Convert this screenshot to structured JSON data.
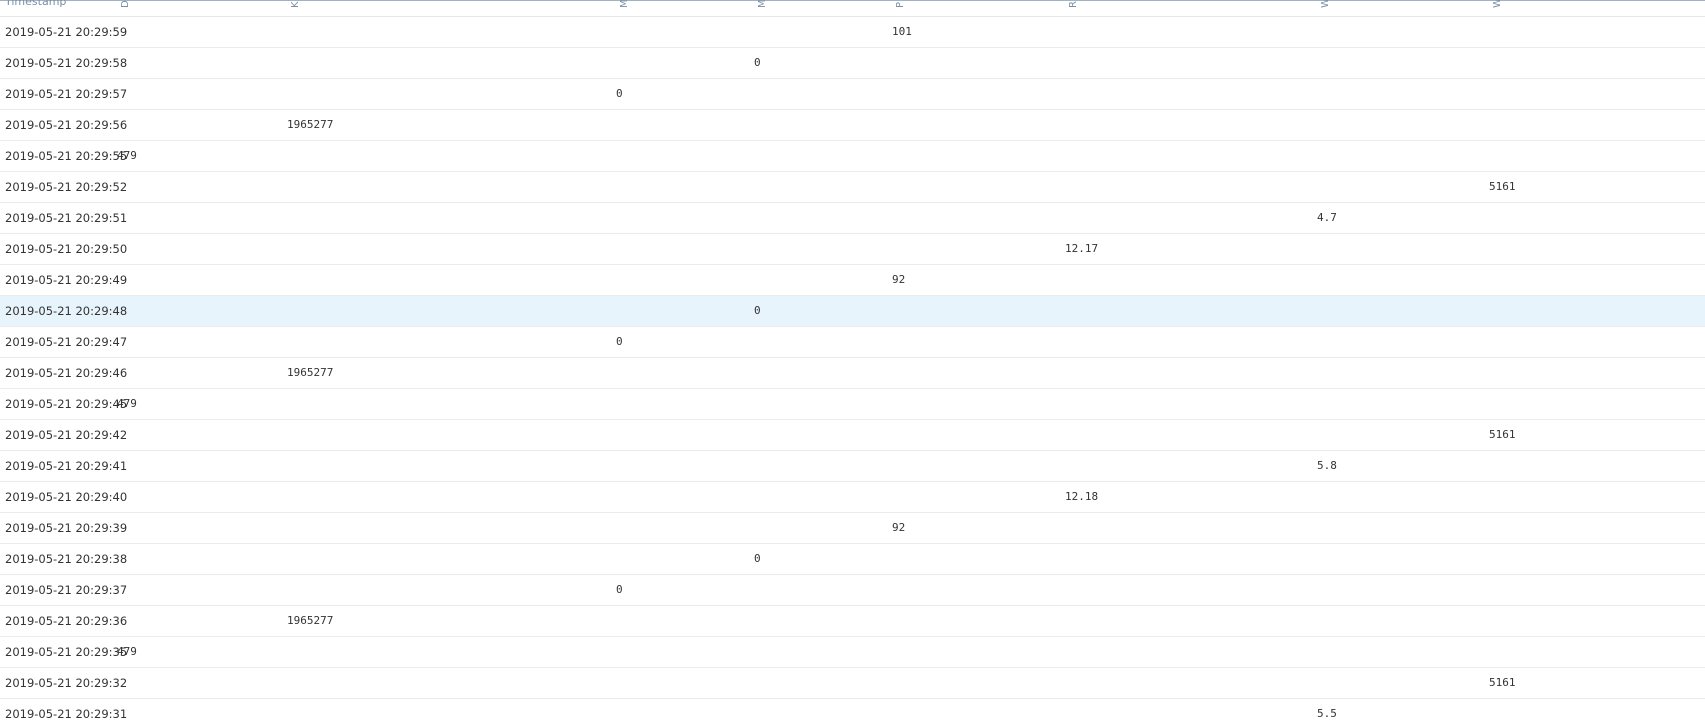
{
  "header": {
    "timestamp_label": "Timestamp",
    "columns": [
      "D",
      "K",
      "M",
      "M",
      "P",
      "R",
      "W",
      "W"
    ]
  },
  "rows": [
    {
      "timestamp": "2019-05-21 20:29:59",
      "col": 4,
      "value": "101"
    },
    {
      "timestamp": "2019-05-21 20:29:58",
      "col": 3,
      "value": "0"
    },
    {
      "timestamp": "2019-05-21 20:29:57",
      "col": 2,
      "value": "0"
    },
    {
      "timestamp": "2019-05-21 20:29:56",
      "col": 1,
      "value": "1965277"
    },
    {
      "timestamp": "2019-05-21 20:29:55",
      "col": 0,
      "value": "479"
    },
    {
      "timestamp": "2019-05-21 20:29:52",
      "col": 7,
      "value": "5161"
    },
    {
      "timestamp": "2019-05-21 20:29:51",
      "col": 6,
      "value": "4.7"
    },
    {
      "timestamp": "2019-05-21 20:29:50",
      "col": 5,
      "value": "12.17"
    },
    {
      "timestamp": "2019-05-21 20:29:49",
      "col": 4,
      "value": "92"
    },
    {
      "timestamp": "2019-05-21 20:29:48",
      "col": 3,
      "value": "0",
      "selected": true
    },
    {
      "timestamp": "2019-05-21 20:29:47",
      "col": 2,
      "value": "0"
    },
    {
      "timestamp": "2019-05-21 20:29:46",
      "col": 1,
      "value": "1965277"
    },
    {
      "timestamp": "2019-05-21 20:29:45",
      "col": 0,
      "value": "479"
    },
    {
      "timestamp": "2019-05-21 20:29:42",
      "col": 7,
      "value": "5161"
    },
    {
      "timestamp": "2019-05-21 20:29:41",
      "col": 6,
      "value": "5.8"
    },
    {
      "timestamp": "2019-05-21 20:29:40",
      "col": 5,
      "value": "12.18"
    },
    {
      "timestamp": "2019-05-21 20:29:39",
      "col": 4,
      "value": "92"
    },
    {
      "timestamp": "2019-05-21 20:29:38",
      "col": 3,
      "value": "0"
    },
    {
      "timestamp": "2019-05-21 20:29:37",
      "col": 2,
      "value": "0"
    },
    {
      "timestamp": "2019-05-21 20:29:36",
      "col": 1,
      "value": "1965277"
    },
    {
      "timestamp": "2019-05-21 20:29:35",
      "col": 0,
      "value": "479"
    },
    {
      "timestamp": "2019-05-21 20:29:32",
      "col": 7,
      "value": "5161"
    },
    {
      "timestamp": "2019-05-21 20:29:31",
      "col": 6,
      "value": "5.5"
    }
  ]
}
